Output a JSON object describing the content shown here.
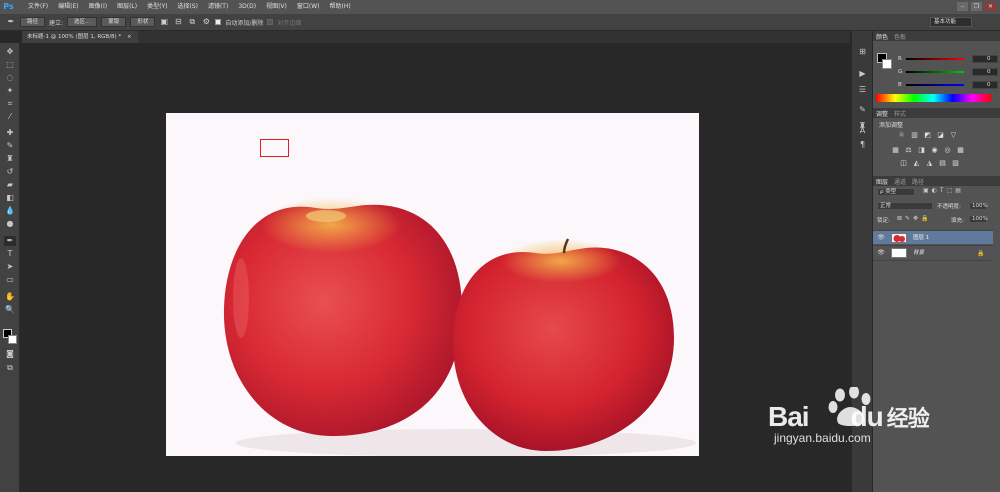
{
  "app": {
    "logo": "Ps"
  },
  "menubar": {
    "items": [
      "文件(F)",
      "编辑(E)",
      "图像(I)",
      "图层(L)",
      "类型(Y)",
      "选择(S)",
      "滤镜(T)",
      "3D(D)",
      "视图(V)",
      "窗口(W)",
      "帮助(H)"
    ]
  },
  "options": {
    "path_mode": "路径",
    "make_label": "建立:",
    "selection_btn": "选区...",
    "mask_btn": "蒙版",
    "shape_btn": "形状",
    "auto_add_delete": "自动添加/删除",
    "align_edges": "对齐边缘",
    "workspace": "基本功能"
  },
  "document": {
    "tab_title": "未标题-1 @ 100% (图层 1, RGB/8) *",
    "close": "×"
  },
  "panels": {
    "color_tab": "颜色",
    "swatches_tab": "色板",
    "r_label": "R",
    "g_label": "G",
    "b_label": "B",
    "r_value": "0",
    "g_value": "0",
    "b_value": "0",
    "adjust_tab": "调整",
    "styles_tab": "样式",
    "add_adjust": "添加调整",
    "layers_tab": "图层",
    "channels_tab": "通道",
    "paths_tab": "路径",
    "kind_label": "ρ 类型",
    "blend_mode": "正常",
    "opacity_label": "不透明度:",
    "opacity_value": "100%",
    "lock_label": "锁定:",
    "fill_label": "填充:",
    "fill_value": "100%",
    "layers": [
      {
        "name": "图层 1"
      },
      {
        "name": "背景"
      }
    ]
  },
  "watermark": {
    "brand_a": "Bai",
    "brand_b": "du",
    "brand_c": "经验",
    "url": "jingyan.baidu.com"
  },
  "colors": {
    "accent": "#33a8ff",
    "selection": "#e02020",
    "layer_selected": "#5f7a9a",
    "panel_bg": "#535353"
  }
}
